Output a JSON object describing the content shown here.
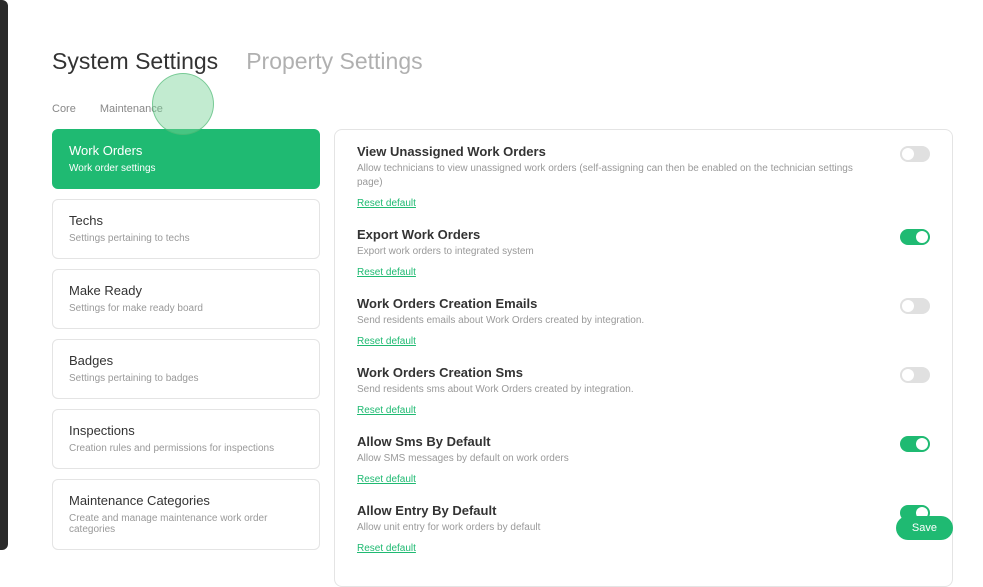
{
  "topTabs": {
    "system": "System Settings",
    "property": "Property Settings"
  },
  "subTabs": {
    "core": "Core",
    "maintenance": "Maintenance"
  },
  "sidebar": {
    "items": [
      {
        "title": "Work Orders",
        "sub": "Work order settings"
      },
      {
        "title": "Techs",
        "sub": "Settings pertaining to techs"
      },
      {
        "title": "Make Ready",
        "sub": "Settings for make ready board"
      },
      {
        "title": "Badges",
        "sub": "Settings pertaining to badges"
      },
      {
        "title": "Inspections",
        "sub": "Creation rules and permissions for inspections"
      },
      {
        "title": "Maintenance Categories",
        "sub": "Create and manage maintenance work order categories"
      }
    ]
  },
  "settings": [
    {
      "title": "View Unassigned Work Orders",
      "desc": "Allow technicians to view unassigned work orders (self-assigning can then be enabled on the technician settings page)",
      "reset": "Reset default",
      "on": false
    },
    {
      "title": "Export Work Orders",
      "desc": "Export work orders to integrated system",
      "reset": "Reset default",
      "on": true
    },
    {
      "title": "Work Orders Creation Emails",
      "desc": "Send residents emails about Work Orders created by integration.",
      "reset": "Reset default",
      "on": false
    },
    {
      "title": "Work Orders Creation Sms",
      "desc": "Send residents sms about Work Orders created by integration.",
      "reset": "Reset default",
      "on": false
    },
    {
      "title": "Allow Sms By Default",
      "desc": "Allow SMS messages by default on work orders",
      "reset": "Reset default",
      "on": true
    },
    {
      "title": "Allow Entry By Default",
      "desc": "Allow unit entry for work orders by default",
      "reset": "Reset default",
      "on": true
    }
  ],
  "saveLabel": "Save"
}
